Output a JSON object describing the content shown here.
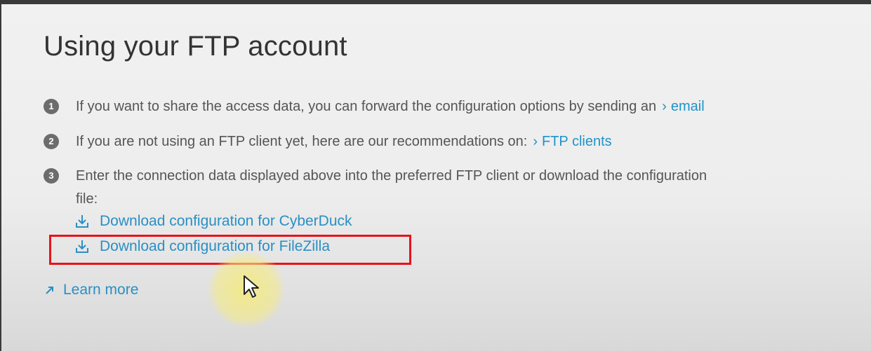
{
  "title": "Using your FTP account",
  "steps": [
    {
      "num": "1",
      "text": "If you want to share the access data, you can forward the configuration options by sending an",
      "link": "email"
    },
    {
      "num": "2",
      "text": "If you are not using an FTP client yet, here are our recommendations on:",
      "link": "FTP clients"
    },
    {
      "num": "3",
      "line1": "Enter the connection data displayed above into the preferred FTP client  or download the configuration",
      "line2": "file:"
    }
  ],
  "downloads": [
    {
      "label": "Download configuration for CyberDuck",
      "icon": "download-icon"
    },
    {
      "label": "Download configuration for FileZilla",
      "icon": "download-icon"
    }
  ],
  "learn_more": {
    "label": "Learn more",
    "icon": "external-arrow-icon"
  },
  "colors": {
    "link": "#1f93c9",
    "highlight": "#e8121b",
    "cursor_halo": "#f5eb78"
  }
}
